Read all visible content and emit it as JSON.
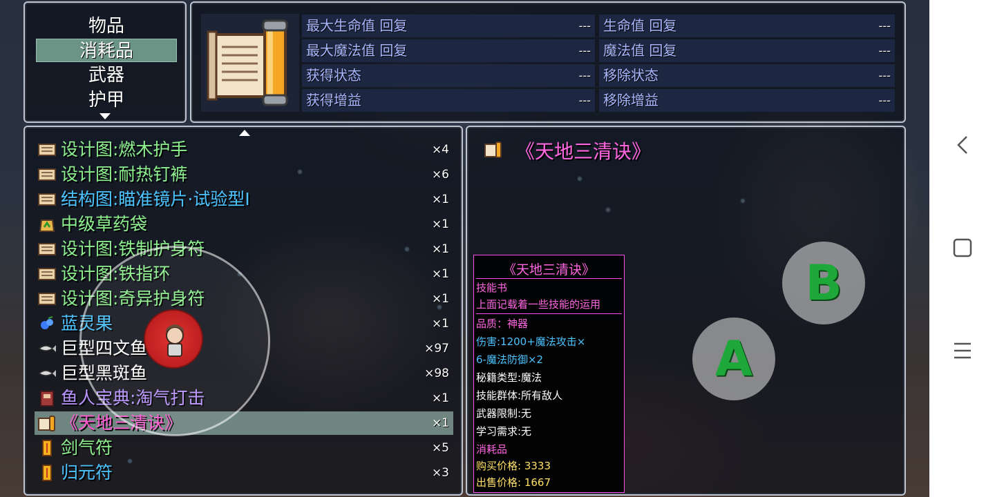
{
  "categories": {
    "items": [
      "物品",
      "消耗品",
      "武器",
      "护甲"
    ],
    "selected_index": 1
  },
  "status": {
    "rows": [
      {
        "label": "最大生命值 回复",
        "value": "---"
      },
      {
        "label": "生命值 回复",
        "value": "---"
      },
      {
        "label": "最大魔法值 回复",
        "value": "---"
      },
      {
        "label": "魔法值 回复",
        "value": "---"
      },
      {
        "label": "获得状态",
        "value": "---"
      },
      {
        "label": "移除状态",
        "value": "---"
      },
      {
        "label": "获得增益",
        "value": "---"
      },
      {
        "label": "移除增益",
        "value": "---"
      }
    ]
  },
  "items": [
    {
      "name": "设计图:燃木护手",
      "count": "×4",
      "color": "green",
      "icon": "scroll-icon"
    },
    {
      "name": "设计图:耐热钉裤",
      "count": "×6",
      "color": "green",
      "icon": "scroll-icon"
    },
    {
      "name": "结构图:瞄准镜片·试验型I",
      "count": "×1",
      "color": "blue",
      "icon": "scroll-icon"
    },
    {
      "name": "中级草药袋",
      "count": "×1",
      "color": "green",
      "icon": "herb-bag-icon"
    },
    {
      "name": "设计图:铁制护身符",
      "count": "×1",
      "color": "green",
      "icon": "scroll-icon"
    },
    {
      "name": "设计图:铁指环",
      "count": "×1",
      "color": "green",
      "icon": "scroll-icon"
    },
    {
      "name": "设计图:奇异护身符",
      "count": "×1",
      "color": "green",
      "icon": "scroll-icon"
    },
    {
      "name": "蓝灵果",
      "count": "×1",
      "color": "blue",
      "icon": "blue-fruit-icon"
    },
    {
      "name": "巨型四文鱼",
      "count": "×97",
      "color": "white",
      "icon": "fish-icon"
    },
    {
      "name": "巨型黑斑鱼",
      "count": "×98",
      "color": "white",
      "icon": "fish-icon"
    },
    {
      "name": "鱼人宝典:淘气打击",
      "count": "×1",
      "color": "purple",
      "icon": "book-icon"
    },
    {
      "name": "《天地三清诀》",
      "count": "×1",
      "color": "magenta",
      "icon": "skill-book-icon"
    },
    {
      "name": "剑气符",
      "count": "×5",
      "color": "green",
      "icon": "talisman-icon"
    },
    {
      "name": "归元符",
      "count": "×3",
      "color": "blue",
      "icon": "talisman-icon"
    }
  ],
  "selected_item_index": 11,
  "help": {
    "title": "《天地三清诀》"
  },
  "tooltip": {
    "title": "《天地三清诀》",
    "type": "技能书",
    "desc": "上面记载着一些技能的运用",
    "quality": "品质：神器",
    "damage1": "伤害:1200+魔法攻击×",
    "damage2": "6-魔法防御×2",
    "skill_type": "秘籍类型:魔法",
    "target": "技能群体:所有敌人",
    "weapon_limit": "武器限制:无",
    "learn_req": "学习需求:无",
    "category": "消耗品",
    "buy_price": "购买价格: 3333",
    "sell_price": "出售价格: 1667"
  },
  "controls": {
    "a_label": "A",
    "b_label": "B"
  },
  "colors": {
    "green": "#8ef08e",
    "blue": "#4cc3ff",
    "white": "#ffffff",
    "purple": "#b894ff",
    "magenta": "#ff5ad2",
    "tooltip_border": "#ff4fe8"
  }
}
